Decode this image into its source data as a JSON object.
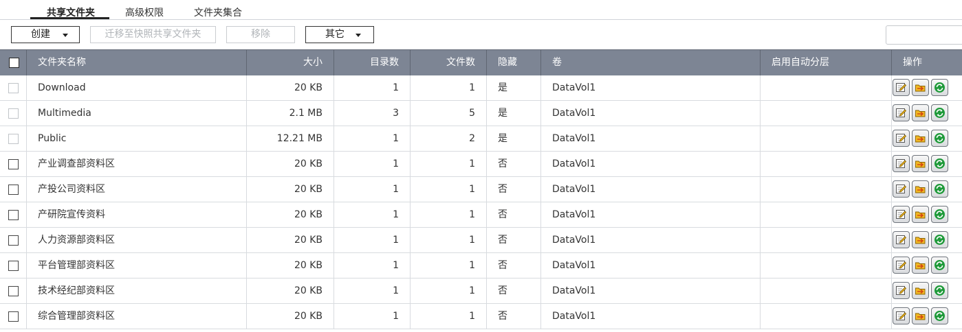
{
  "tabs": [
    {
      "label": "共享文件夹",
      "active": true
    },
    {
      "label": "高级权限",
      "active": false
    },
    {
      "label": "文件夹集合",
      "active": false
    }
  ],
  "toolbar": {
    "create_label": "创建",
    "migrate_label": "迁移至快照共享文件夹",
    "remove_label": "移除",
    "other_label": "其它",
    "search_placeholder": ""
  },
  "table": {
    "columns": [
      "文件夹名称",
      "大小",
      "目录数",
      "文件数",
      "隐藏",
      "卷",
      "启用自动分层",
      "操作"
    ],
    "rows": [
      {
        "name": "Download",
        "size": "20 KB",
        "dirs": "1",
        "files": "1",
        "hidden": "是",
        "volume": "DataVol1",
        "tiering": "",
        "system": true
      },
      {
        "name": "Multimedia",
        "size": "2.1 MB",
        "dirs": "3",
        "files": "5",
        "hidden": "是",
        "volume": "DataVol1",
        "tiering": "",
        "system": true
      },
      {
        "name": "Public",
        "size": "12.21 MB",
        "dirs": "1",
        "files": "2",
        "hidden": "是",
        "volume": "DataVol1",
        "tiering": "",
        "system": true
      },
      {
        "name": "产业调查部资料区",
        "size": "20 KB",
        "dirs": "1",
        "files": "1",
        "hidden": "否",
        "volume": "DataVol1",
        "tiering": "",
        "system": false
      },
      {
        "name": "产投公司资料区",
        "size": "20 KB",
        "dirs": "1",
        "files": "1",
        "hidden": "否",
        "volume": "DataVol1",
        "tiering": "",
        "system": false
      },
      {
        "name": "产研院宣传资料",
        "size": "20 KB",
        "dirs": "1",
        "files": "1",
        "hidden": "否",
        "volume": "DataVol1",
        "tiering": "",
        "system": false
      },
      {
        "name": "人力资源部资料区",
        "size": "20 KB",
        "dirs": "1",
        "files": "1",
        "hidden": "否",
        "volume": "DataVol1",
        "tiering": "",
        "system": false
      },
      {
        "name": "平台管理部资料区",
        "size": "20 KB",
        "dirs": "1",
        "files": "1",
        "hidden": "否",
        "volume": "DataVol1",
        "tiering": "",
        "system": false
      },
      {
        "name": "技术经纪部资料区",
        "size": "20 KB",
        "dirs": "1",
        "files": "1",
        "hidden": "否",
        "volume": "DataVol1",
        "tiering": "",
        "system": false
      },
      {
        "name": "综合管理部资料区",
        "size": "20 KB",
        "dirs": "1",
        "files": "1",
        "hidden": "否",
        "volume": "DataVol1",
        "tiering": "",
        "system": false
      }
    ],
    "action_icons": [
      "edit-properties-icon",
      "edit-permissions-icon",
      "refresh-icon"
    ]
  },
  "colors": {
    "header_bg": "#7d8594",
    "header_text": "#ffffff",
    "row_border": "#d8dbdf",
    "refresh_green": "#1f9a3a",
    "folder_yellow": "#f2b824"
  }
}
